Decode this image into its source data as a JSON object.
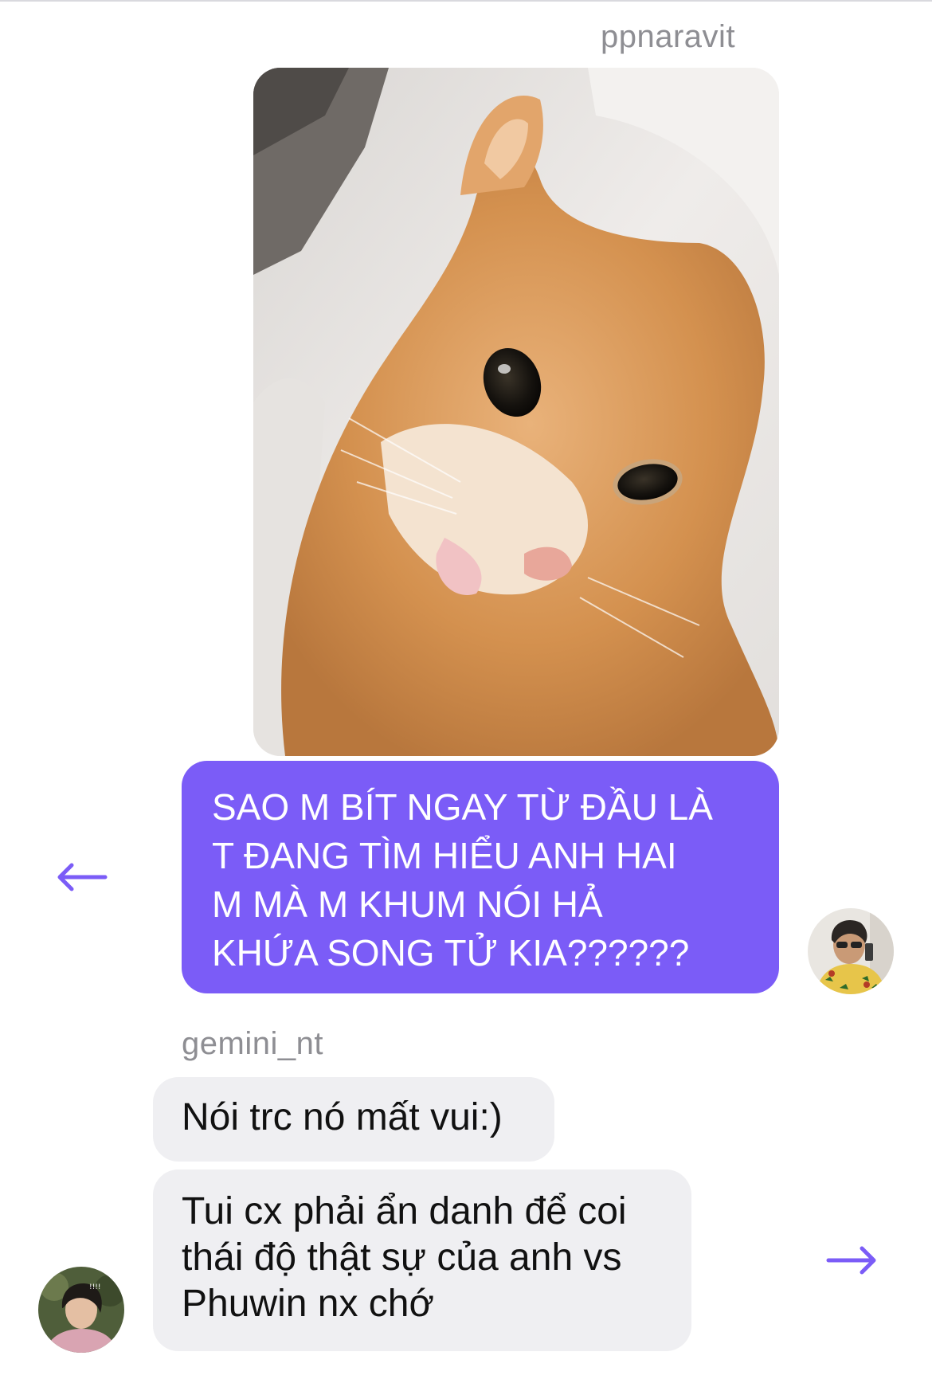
{
  "colors": {
    "accent": "#7b5cf7",
    "incoming_bubble": "#efeff2",
    "sender_name": "#8e8e93"
  },
  "messages": {
    "outgoing": {
      "sender": "ppnaravit",
      "image_description": "cat-photo",
      "text_lines": [
        "SAO M BÍT NGAY TỪ ĐẦU LÀ",
        "T ĐANG TÌM HIỂU ANH HAI",
        "M MÀ M KHUM NÓI HẢ",
        "KHỨA SONG TỬ KIA??????"
      ]
    },
    "incoming": {
      "sender": "gemini_nt",
      "bubble1": "Nói trc nó mất vui:)",
      "bubble2_lines": [
        "Tui cx phải ẩn danh để coi",
        "thái độ thật sự của anh vs",
        "Phuwin nx chớ"
      ]
    }
  },
  "icons": {
    "left": "arrow-left-icon",
    "right": "arrow-right-icon"
  }
}
